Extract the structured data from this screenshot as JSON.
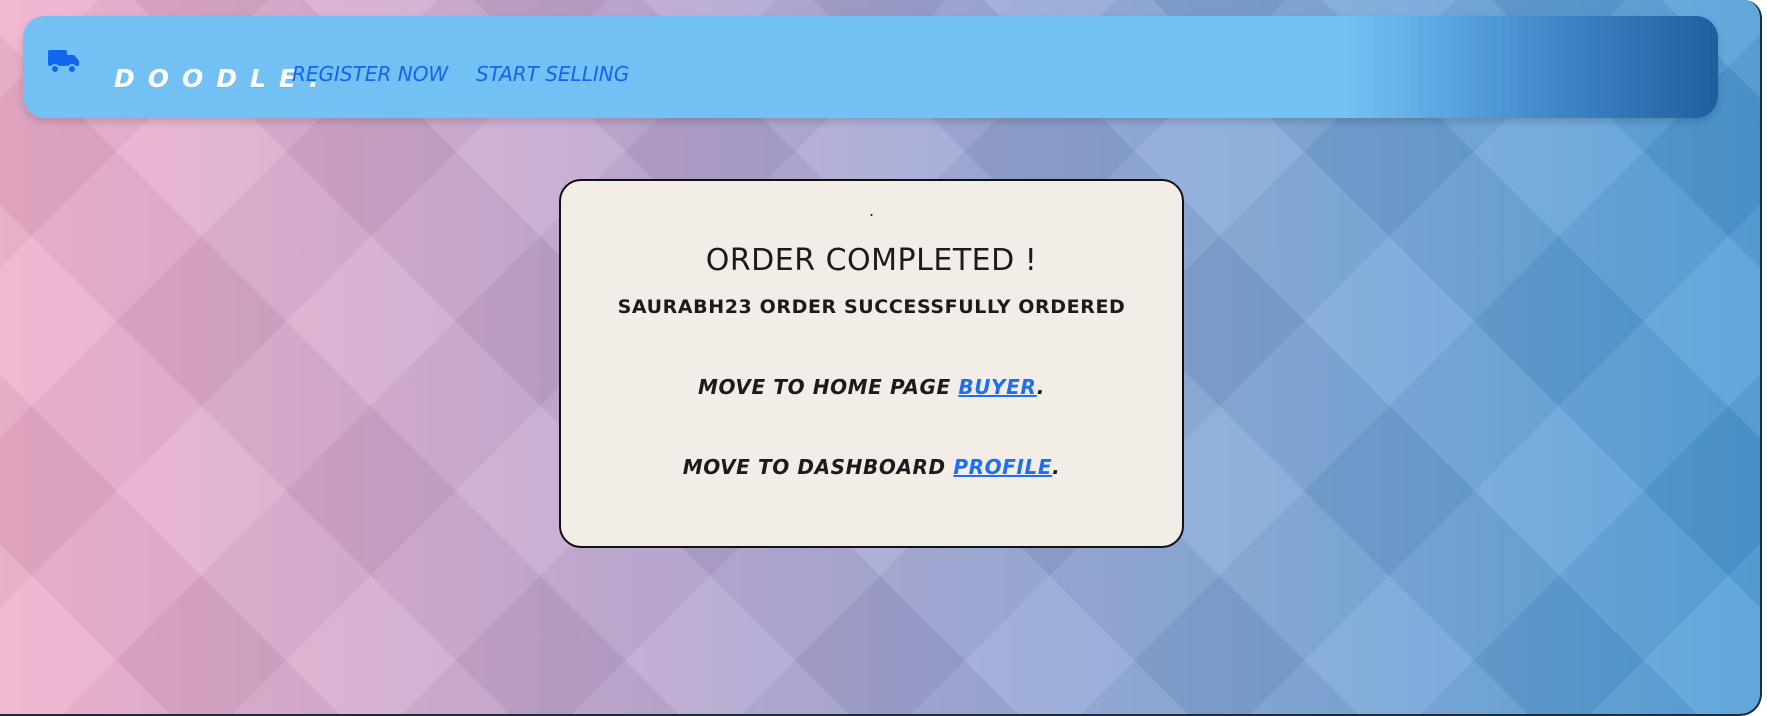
{
  "navbar": {
    "brand": "Doodle.",
    "links": [
      {
        "label": "Register now"
      },
      {
        "label": "Start selling"
      }
    ]
  },
  "card": {
    "dot": ".",
    "title": "ORDER COMPLETED !",
    "subtitle": "SAURABH23 ORDER SUCCESSFULLY ORDERED",
    "home_text": "MOVE TO HOME PAGE ",
    "home_link": "BUYER",
    "home_suffix": ".",
    "dash_text": "MOVE TO DASHBOARD ",
    "dash_link": "PROFILE",
    "dash_suffix": "."
  },
  "icons": {
    "brand_icon": "truck-icon"
  },
  "colors": {
    "nav_bg": "#72c0f4",
    "link": "#1266ee",
    "card_bg": "#f3ede8"
  }
}
